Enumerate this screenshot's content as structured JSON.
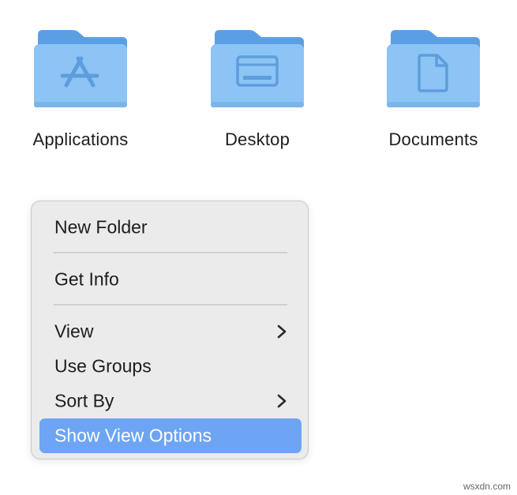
{
  "folders": [
    {
      "name": "Applications",
      "icon": "app-store-icon"
    },
    {
      "name": "Desktop",
      "icon": "desktop-window-icon"
    },
    {
      "name": "Documents",
      "icon": "document-page-icon"
    }
  ],
  "menu": {
    "items": [
      {
        "label": "New Folder"
      },
      {
        "label": "Get Info"
      },
      {
        "label": "View",
        "submenu": true
      },
      {
        "label": "Use Groups"
      },
      {
        "label": "Sort By",
        "submenu": true
      },
      {
        "label": "Show View Options",
        "highlighted": true
      }
    ]
  },
  "colors": {
    "folder_body": "#8cc4f5",
    "folder_tab": "#5c9ee4",
    "folder_glyph": "#5e9ddc",
    "menu_background": "#ebebeb",
    "highlight": "#6da5f4"
  },
  "watermark": "wsxdn.com"
}
